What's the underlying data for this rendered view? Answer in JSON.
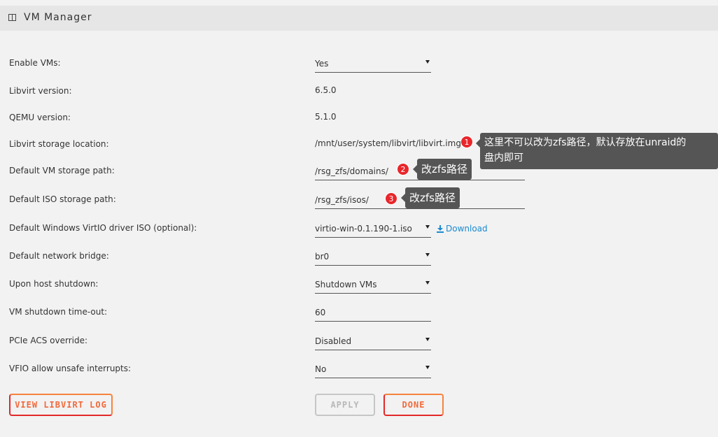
{
  "header": {
    "title": "VM Manager",
    "icon": "panel-icon"
  },
  "settings": {
    "enable_vms": {
      "label": "Enable VMs:",
      "value": "Yes"
    },
    "libvirt_version": {
      "label": "Libvirt version:",
      "value": "6.5.0"
    },
    "qemu_version": {
      "label": "QEMU version:",
      "value": "5.1.0"
    },
    "libvirt_storage": {
      "label": "Libvirt storage location:",
      "value": "/mnt/user/system/libvirt/libvirt.img"
    },
    "vm_storage_path": {
      "label": "Default VM storage path:",
      "value": "/rsg_zfs/domains/"
    },
    "iso_storage_path": {
      "label": "Default ISO storage path:",
      "value": "/rsg_zfs/isos/"
    },
    "virtio_iso": {
      "label": "Default Windows VirtIO driver ISO (optional):",
      "value": "virtio-win-0.1.190-1.iso",
      "download_label": "Download"
    },
    "network_bridge": {
      "label": "Default network bridge:",
      "value": "br0"
    },
    "host_shutdown": {
      "label": "Upon host shutdown:",
      "value": "Shutdown VMs"
    },
    "shutdown_timeout": {
      "label": "VM shutdown time-out:",
      "value": "60"
    },
    "pcie_acs": {
      "label": "PCIe ACS override:",
      "value": "Disabled"
    },
    "vfio_unsafe": {
      "label": "VFIO allow unsafe interrupts:",
      "value": "No"
    }
  },
  "annotations": [
    {
      "number": "1",
      "text_line1": "这里不可以改为zfs路径，默认存放在unraid的",
      "text_line2": "盘内即可"
    },
    {
      "number": "2",
      "text": "改zfs路径"
    },
    {
      "number": "3",
      "text": "改zfs路径"
    }
  ],
  "buttons": {
    "view_log": "VIEW LIBVIRT LOG",
    "apply": "APPLY",
    "done": "DONE"
  },
  "colors": {
    "accent_orange": "#f6843e",
    "accent_red": "#e22828",
    "link_blue": "#1a8ad1",
    "badge_red": "#e8262b"
  }
}
